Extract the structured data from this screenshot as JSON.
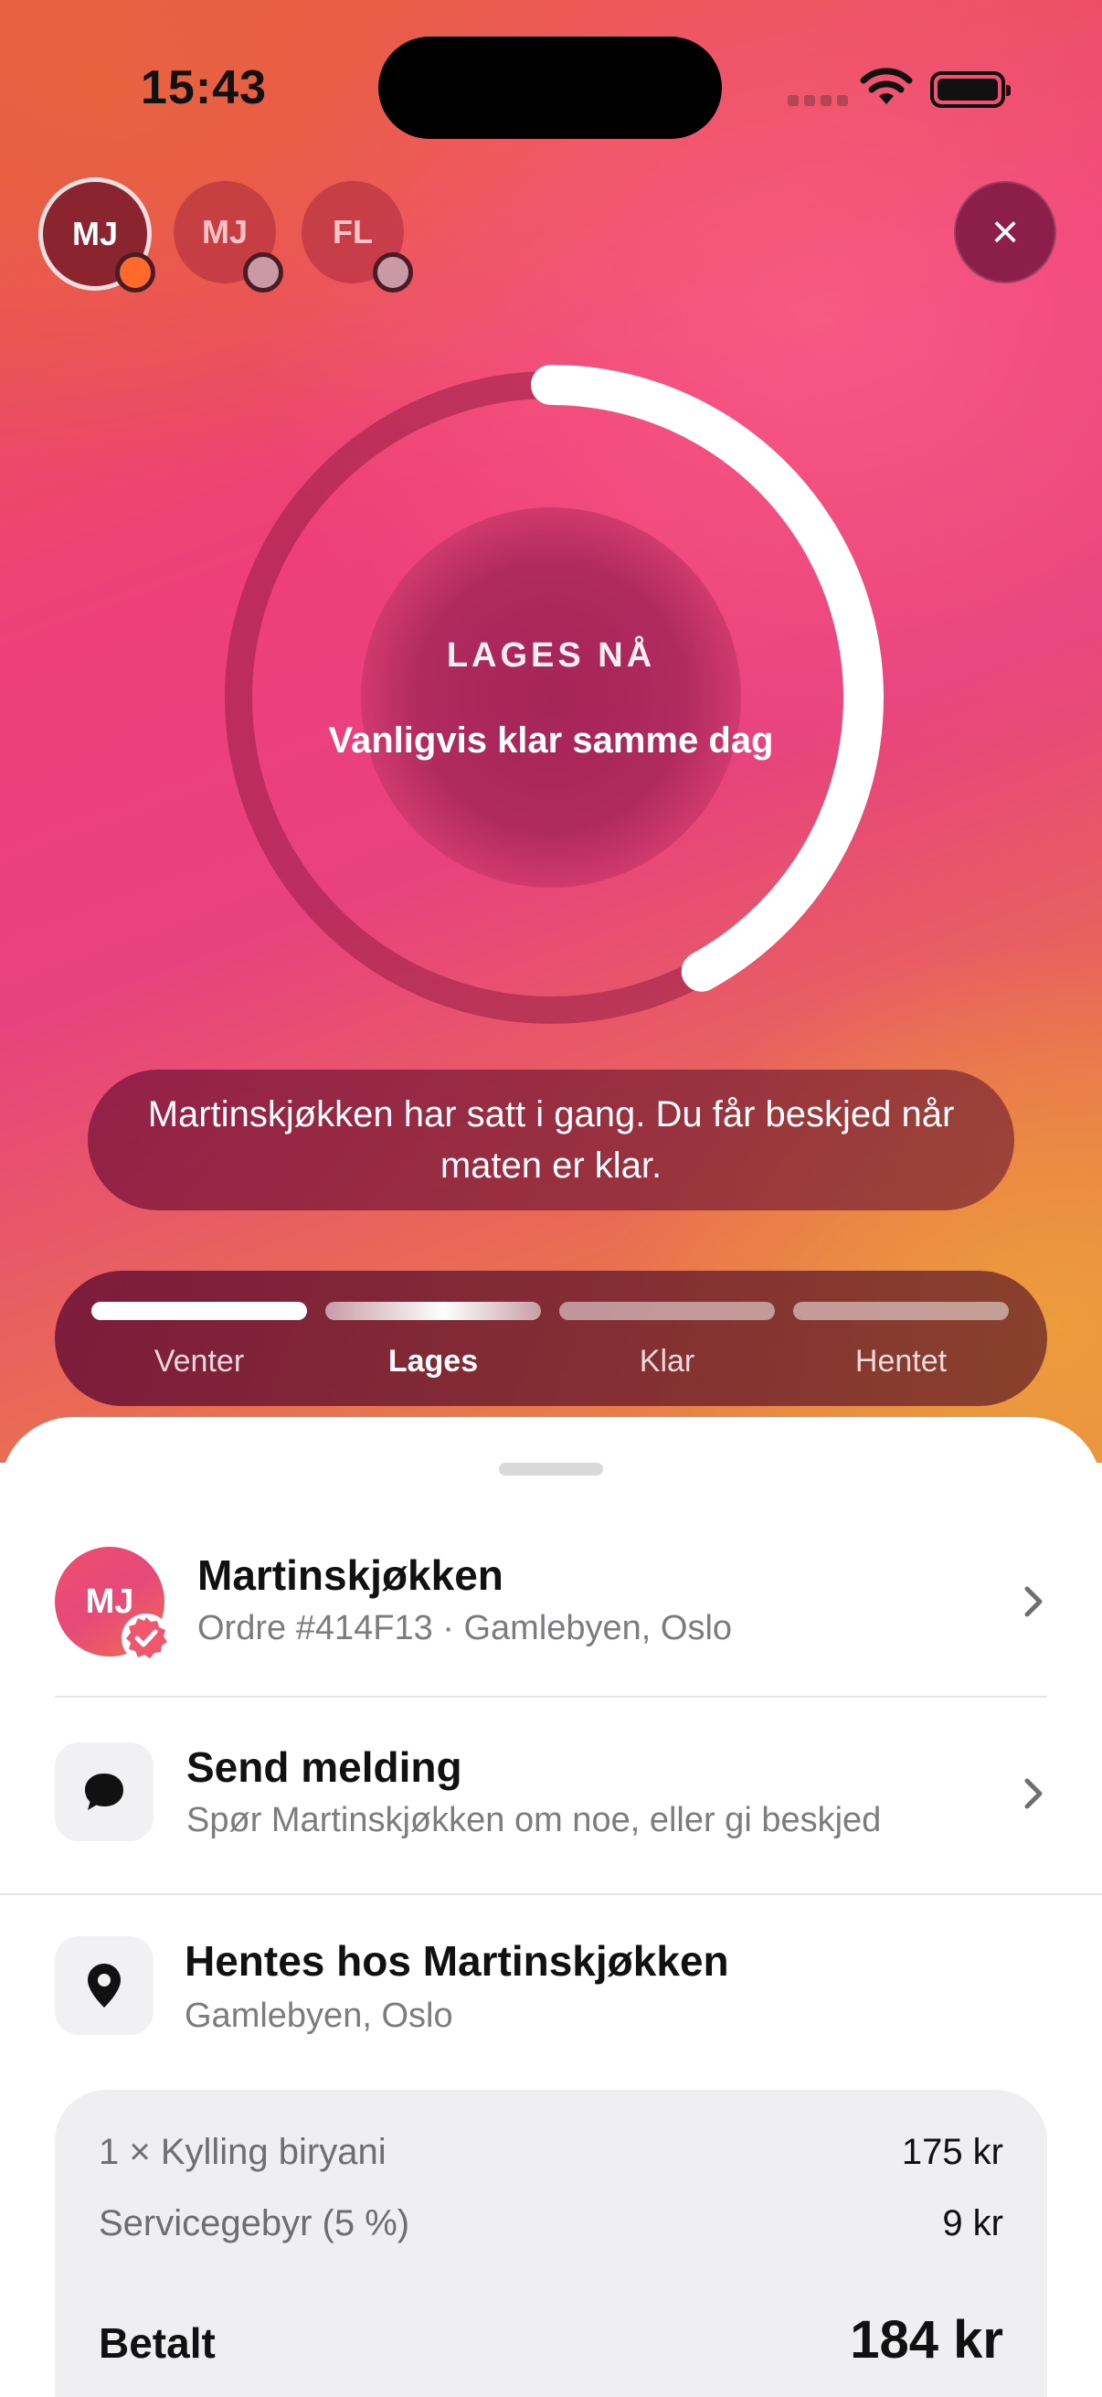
{
  "status_bar": {
    "time": "15:43"
  },
  "avatars": [
    {
      "initials": "MJ",
      "active": true,
      "dot_color": "#ff6a2a"
    },
    {
      "initials": "MJ",
      "active": false,
      "dot_color": "#c99aa6"
    },
    {
      "initials": "FL",
      "active": false,
      "dot_color": "#c99aa6"
    }
  ],
  "close_icon": "×",
  "progress": {
    "fraction": 0.42,
    "label": "LAGES NÅ",
    "sublabel": "Vanligvis klar samme dag"
  },
  "message": "Martinskjøkken har satt i gang. Du får beskjed når maten er klar.",
  "stages": [
    {
      "label": "Venter",
      "state": "done"
    },
    {
      "label": "Lages",
      "state": "current"
    },
    {
      "label": "Klar",
      "state": "pending"
    },
    {
      "label": "Hentet",
      "state": "pending"
    }
  ],
  "merchant": {
    "initials": "MJ",
    "name": "Martinskjøkken",
    "subtitle": "Ordre #414F13 · Gamlebyen, Oslo"
  },
  "send_message": {
    "icon": "chat-bubble-icon",
    "title": "Send melding",
    "subtitle": "Spør Martinskjøkken om noe, eller gi beskjed"
  },
  "pickup": {
    "icon": "location-pin-icon",
    "title": "Hentes hos Martinskjøkken",
    "subtitle": "Gamlebyen, Oslo"
  },
  "receipt": {
    "items": [
      {
        "label": "1 × Kylling biryani",
        "amount": "175 kr"
      },
      {
        "label": "Servicegebyr (5 %)",
        "amount": "9 kr"
      }
    ],
    "total_label": "Betalt",
    "total_amount": "184 kr"
  },
  "colors": {
    "accent": "#e8427e",
    "active_dot": "#ff6a2a"
  }
}
